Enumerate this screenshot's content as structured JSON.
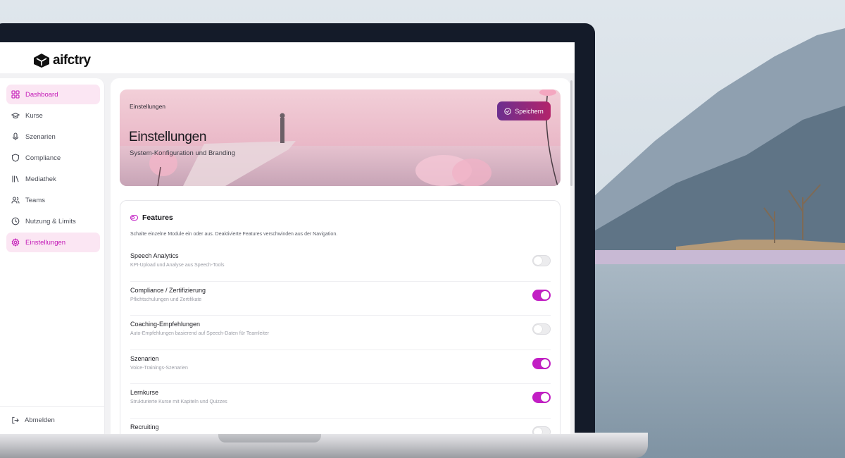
{
  "brand": {
    "logo_text": "aifctry",
    "logo_icon": "cube-logo-icon"
  },
  "sidebar": {
    "items": [
      {
        "label": "Dashboard",
        "icon": "grid-icon",
        "active": true
      },
      {
        "label": "Kurse",
        "icon": "graduation-cap-icon",
        "active": false
      },
      {
        "label": "Szenarien",
        "icon": "microphone-icon",
        "active": false
      },
      {
        "label": "Compliance",
        "icon": "shield-icon",
        "active": false
      },
      {
        "label": "Mediathek",
        "icon": "library-icon",
        "active": false
      },
      {
        "label": "Teams",
        "icon": "users-icon",
        "active": false
      },
      {
        "label": "Nutzung & Limits",
        "icon": "clock-icon",
        "active": false
      },
      {
        "label": "Einstellungen",
        "icon": "gear-icon",
        "active": true
      }
    ],
    "logout_label": "Abmelden"
  },
  "hero": {
    "breadcrumb": "Einstellungen",
    "title": "Einstellungen",
    "subtitle": "System-Konfiguration und Branding",
    "save_label": "Speichern"
  },
  "features": {
    "title": "Features",
    "description": "Schalte einzelne Module ein oder aus. Deaktivierte Features verschwinden aus der Navigation.",
    "items": [
      {
        "name": "Speech Analytics",
        "desc": "KPI-Upload und Analyse aus Speech-Tools",
        "enabled": false
      },
      {
        "name": "Compliance / Zertifizierung",
        "desc": "Pflichtschulungen und Zertifikate",
        "enabled": true
      },
      {
        "name": "Coaching-Empfehlungen",
        "desc": "Auto-Empfehlungen basierend auf Speech-Daten für Teamleiter",
        "enabled": false
      },
      {
        "name": "Szenarien",
        "desc": "Voice-Trainings-Szenarien",
        "enabled": true
      },
      {
        "name": "Lernkurse",
        "desc": "Strukturierte Kurse mit Kapiteln und Quizzes",
        "enabled": true
      },
      {
        "name": "Recruiting",
        "desc": "",
        "enabled": false
      }
    ]
  },
  "colors": {
    "accent": "#c21fc4",
    "active_bg": "#fbe6f3",
    "button_start": "#6c2f8f",
    "button_end": "#b3236b"
  }
}
